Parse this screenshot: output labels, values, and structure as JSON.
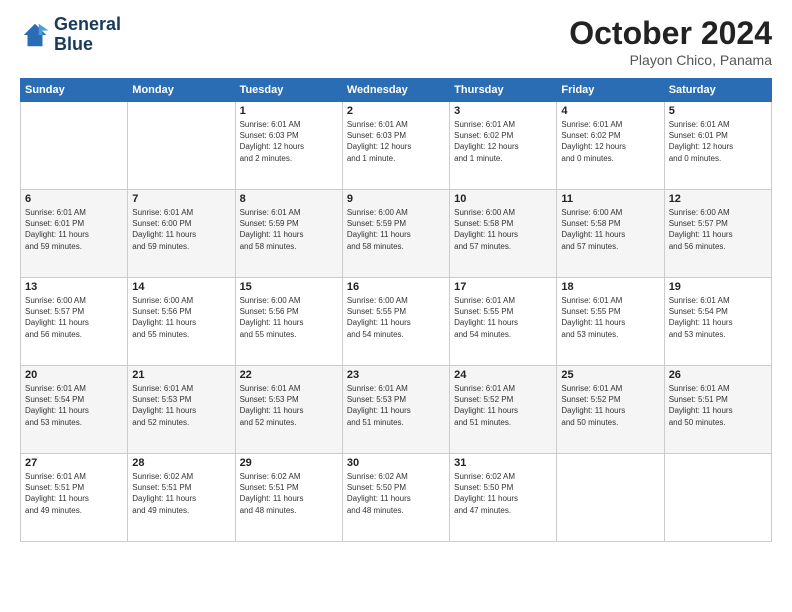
{
  "header": {
    "logo_line1": "General",
    "logo_line2": "Blue",
    "month": "October 2024",
    "location": "Playon Chico, Panama"
  },
  "weekdays": [
    "Sunday",
    "Monday",
    "Tuesday",
    "Wednesday",
    "Thursday",
    "Friday",
    "Saturday"
  ],
  "weeks": [
    [
      {
        "day": "",
        "info": ""
      },
      {
        "day": "",
        "info": ""
      },
      {
        "day": "1",
        "info": "Sunrise: 6:01 AM\nSunset: 6:03 PM\nDaylight: 12 hours\nand 2 minutes."
      },
      {
        "day": "2",
        "info": "Sunrise: 6:01 AM\nSunset: 6:03 PM\nDaylight: 12 hours\nand 1 minute."
      },
      {
        "day": "3",
        "info": "Sunrise: 6:01 AM\nSunset: 6:02 PM\nDaylight: 12 hours\nand 1 minute."
      },
      {
        "day": "4",
        "info": "Sunrise: 6:01 AM\nSunset: 6:02 PM\nDaylight: 12 hours\nand 0 minutes."
      },
      {
        "day": "5",
        "info": "Sunrise: 6:01 AM\nSunset: 6:01 PM\nDaylight: 12 hours\nand 0 minutes."
      }
    ],
    [
      {
        "day": "6",
        "info": "Sunrise: 6:01 AM\nSunset: 6:01 PM\nDaylight: 11 hours\nand 59 minutes."
      },
      {
        "day": "7",
        "info": "Sunrise: 6:01 AM\nSunset: 6:00 PM\nDaylight: 11 hours\nand 59 minutes."
      },
      {
        "day": "8",
        "info": "Sunrise: 6:01 AM\nSunset: 5:59 PM\nDaylight: 11 hours\nand 58 minutes."
      },
      {
        "day": "9",
        "info": "Sunrise: 6:00 AM\nSunset: 5:59 PM\nDaylight: 11 hours\nand 58 minutes."
      },
      {
        "day": "10",
        "info": "Sunrise: 6:00 AM\nSunset: 5:58 PM\nDaylight: 11 hours\nand 57 minutes."
      },
      {
        "day": "11",
        "info": "Sunrise: 6:00 AM\nSunset: 5:58 PM\nDaylight: 11 hours\nand 57 minutes."
      },
      {
        "day": "12",
        "info": "Sunrise: 6:00 AM\nSunset: 5:57 PM\nDaylight: 11 hours\nand 56 minutes."
      }
    ],
    [
      {
        "day": "13",
        "info": "Sunrise: 6:00 AM\nSunset: 5:57 PM\nDaylight: 11 hours\nand 56 minutes."
      },
      {
        "day": "14",
        "info": "Sunrise: 6:00 AM\nSunset: 5:56 PM\nDaylight: 11 hours\nand 55 minutes."
      },
      {
        "day": "15",
        "info": "Sunrise: 6:00 AM\nSunset: 5:56 PM\nDaylight: 11 hours\nand 55 minutes."
      },
      {
        "day": "16",
        "info": "Sunrise: 6:00 AM\nSunset: 5:55 PM\nDaylight: 11 hours\nand 54 minutes."
      },
      {
        "day": "17",
        "info": "Sunrise: 6:01 AM\nSunset: 5:55 PM\nDaylight: 11 hours\nand 54 minutes."
      },
      {
        "day": "18",
        "info": "Sunrise: 6:01 AM\nSunset: 5:55 PM\nDaylight: 11 hours\nand 53 minutes."
      },
      {
        "day": "19",
        "info": "Sunrise: 6:01 AM\nSunset: 5:54 PM\nDaylight: 11 hours\nand 53 minutes."
      }
    ],
    [
      {
        "day": "20",
        "info": "Sunrise: 6:01 AM\nSunset: 5:54 PM\nDaylight: 11 hours\nand 53 minutes."
      },
      {
        "day": "21",
        "info": "Sunrise: 6:01 AM\nSunset: 5:53 PM\nDaylight: 11 hours\nand 52 minutes."
      },
      {
        "day": "22",
        "info": "Sunrise: 6:01 AM\nSunset: 5:53 PM\nDaylight: 11 hours\nand 52 minutes."
      },
      {
        "day": "23",
        "info": "Sunrise: 6:01 AM\nSunset: 5:53 PM\nDaylight: 11 hours\nand 51 minutes."
      },
      {
        "day": "24",
        "info": "Sunrise: 6:01 AM\nSunset: 5:52 PM\nDaylight: 11 hours\nand 51 minutes."
      },
      {
        "day": "25",
        "info": "Sunrise: 6:01 AM\nSunset: 5:52 PM\nDaylight: 11 hours\nand 50 minutes."
      },
      {
        "day": "26",
        "info": "Sunrise: 6:01 AM\nSunset: 5:51 PM\nDaylight: 11 hours\nand 50 minutes."
      }
    ],
    [
      {
        "day": "27",
        "info": "Sunrise: 6:01 AM\nSunset: 5:51 PM\nDaylight: 11 hours\nand 49 minutes."
      },
      {
        "day": "28",
        "info": "Sunrise: 6:02 AM\nSunset: 5:51 PM\nDaylight: 11 hours\nand 49 minutes."
      },
      {
        "day": "29",
        "info": "Sunrise: 6:02 AM\nSunset: 5:51 PM\nDaylight: 11 hours\nand 48 minutes."
      },
      {
        "day": "30",
        "info": "Sunrise: 6:02 AM\nSunset: 5:50 PM\nDaylight: 11 hours\nand 48 minutes."
      },
      {
        "day": "31",
        "info": "Sunrise: 6:02 AM\nSunset: 5:50 PM\nDaylight: 11 hours\nand 47 minutes."
      },
      {
        "day": "",
        "info": ""
      },
      {
        "day": "",
        "info": ""
      }
    ]
  ]
}
